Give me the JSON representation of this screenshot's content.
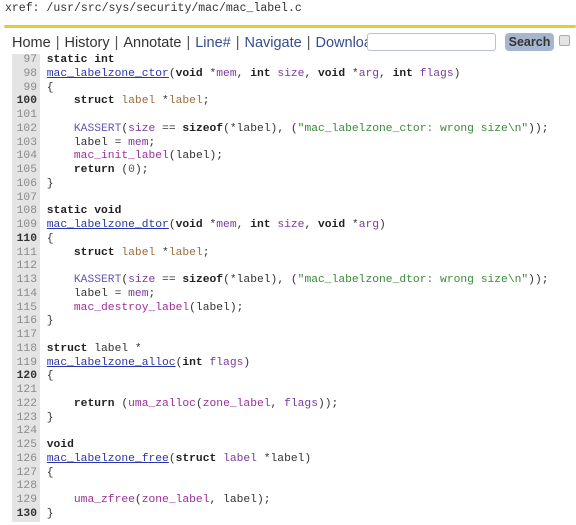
{
  "xref": {
    "prefix": "xref:",
    "path": " /usr/src/sys/security/mac/mac_label.c"
  },
  "nav": {
    "home": "Home",
    "history": "History",
    "annotate": "Annotate",
    "line": "Line#",
    "navigate": "Navigate",
    "download": "Download",
    "separator": "|",
    "search_value": "",
    "search_button": "Search"
  },
  "colors": {
    "accent_line": "#e8c93c",
    "search_button": "#a7b6cf",
    "link": "#364d8c"
  },
  "code": {
    "lines": [
      {
        "n": "97",
        "bold": false,
        "tokens": [
          [
            "kw",
            "static int"
          ]
        ]
      },
      {
        "n": "98",
        "bold": false,
        "tokens": [
          [
            "fn",
            "mac_labelzone_ctor"
          ],
          [
            "src",
            "("
          ],
          [
            "kw",
            "void"
          ],
          [
            "src",
            " *"
          ],
          [
            "var",
            "mem"
          ],
          [
            "src",
            ", "
          ],
          [
            "kw",
            "int"
          ],
          [
            "src",
            " "
          ],
          [
            "var",
            "size"
          ],
          [
            "src",
            ", "
          ],
          [
            "kw",
            "void"
          ],
          [
            "src",
            " *"
          ],
          [
            "var",
            "arg"
          ],
          [
            "src",
            ", "
          ],
          [
            "kw",
            "int"
          ],
          [
            "src",
            " "
          ],
          [
            "var",
            "flags"
          ],
          [
            "src",
            ")"
          ]
        ]
      },
      {
        "n": "99",
        "bold": false,
        "tokens": [
          [
            "src",
            "{"
          ]
        ]
      },
      {
        "n": "100",
        "bold": true,
        "tokens": [
          [
            "src",
            "    "
          ],
          [
            "kw",
            "struct"
          ],
          [
            "src",
            " "
          ],
          [
            "type",
            "label"
          ],
          [
            "src",
            " *"
          ],
          [
            "type",
            "label"
          ],
          [
            "src",
            ";"
          ]
        ]
      },
      {
        "n": "101",
        "bold": false,
        "tokens": []
      },
      {
        "n": "102",
        "bold": false,
        "tokens": [
          [
            "src",
            "    "
          ],
          [
            "mac",
            "KASSERT"
          ],
          [
            "src",
            "("
          ],
          [
            "var",
            "size"
          ],
          [
            "src",
            " == "
          ],
          [
            "kw",
            "sizeof"
          ],
          [
            "src",
            "(*label), ("
          ],
          [
            "str",
            "\"mac_labelzone_ctor: wrong size\\n\""
          ],
          [
            "src",
            "));"
          ]
        ]
      },
      {
        "n": "103",
        "bold": false,
        "tokens": [
          [
            "src",
            "    label = "
          ],
          [
            "var",
            "mem"
          ],
          [
            "src",
            ";"
          ]
        ]
      },
      {
        "n": "104",
        "bold": false,
        "tokens": [
          [
            "src",
            "    "
          ],
          [
            "call",
            "mac_init_label"
          ],
          [
            "src",
            "(label);"
          ]
        ]
      },
      {
        "n": "105",
        "bold": false,
        "tokens": [
          [
            "src",
            "    "
          ],
          [
            "kw",
            "return"
          ],
          [
            "src",
            " ("
          ],
          [
            "num",
            "0"
          ],
          [
            "src",
            ");"
          ]
        ]
      },
      {
        "n": "106",
        "bold": false,
        "tokens": [
          [
            "src",
            "}"
          ]
        ]
      },
      {
        "n": "107",
        "bold": false,
        "tokens": []
      },
      {
        "n": "108",
        "bold": false,
        "tokens": [
          [
            "kw",
            "static void"
          ]
        ]
      },
      {
        "n": "109",
        "bold": false,
        "tokens": [
          [
            "fn",
            "mac_labelzone_dtor"
          ],
          [
            "src",
            "("
          ],
          [
            "kw",
            "void"
          ],
          [
            "src",
            " *"
          ],
          [
            "var",
            "mem"
          ],
          [
            "src",
            ", "
          ],
          [
            "kw",
            "int"
          ],
          [
            "src",
            " "
          ],
          [
            "var",
            "size"
          ],
          [
            "src",
            ", "
          ],
          [
            "kw",
            "void"
          ],
          [
            "src",
            " *"
          ],
          [
            "var",
            "arg"
          ],
          [
            "src",
            ")"
          ]
        ]
      },
      {
        "n": "110",
        "bold": true,
        "tokens": [
          [
            "src",
            "{"
          ]
        ]
      },
      {
        "n": "111",
        "bold": false,
        "tokens": [
          [
            "src",
            "    "
          ],
          [
            "kw",
            "struct"
          ],
          [
            "src",
            " "
          ],
          [
            "type",
            "label"
          ],
          [
            "src",
            " *"
          ],
          [
            "type",
            "label"
          ],
          [
            "src",
            ";"
          ]
        ]
      },
      {
        "n": "112",
        "bold": false,
        "tokens": []
      },
      {
        "n": "113",
        "bold": false,
        "tokens": [
          [
            "src",
            "    "
          ],
          [
            "mac",
            "KASSERT"
          ],
          [
            "src",
            "("
          ],
          [
            "var",
            "size"
          ],
          [
            "src",
            " == "
          ],
          [
            "kw",
            "sizeof"
          ],
          [
            "src",
            "(*label), ("
          ],
          [
            "str",
            "\"mac_labelzone_dtor: wrong size\\n\""
          ],
          [
            "src",
            "));"
          ]
        ]
      },
      {
        "n": "114",
        "bold": false,
        "tokens": [
          [
            "src",
            "    label = "
          ],
          [
            "var",
            "mem"
          ],
          [
            "src",
            ";"
          ]
        ]
      },
      {
        "n": "115",
        "bold": false,
        "tokens": [
          [
            "src",
            "    "
          ],
          [
            "call",
            "mac_destroy_label"
          ],
          [
            "src",
            "(label);"
          ]
        ]
      },
      {
        "n": "116",
        "bold": false,
        "tokens": [
          [
            "src",
            "}"
          ]
        ]
      },
      {
        "n": "117",
        "bold": false,
        "tokens": []
      },
      {
        "n": "118",
        "bold": false,
        "tokens": [
          [
            "kw",
            "struct"
          ],
          [
            "src",
            " label *"
          ]
        ]
      },
      {
        "n": "119",
        "bold": false,
        "tokens": [
          [
            "fn",
            "mac_labelzone_alloc"
          ],
          [
            "src",
            "("
          ],
          [
            "kw",
            "int"
          ],
          [
            "src",
            " "
          ],
          [
            "var",
            "flags"
          ],
          [
            "src",
            ")"
          ]
        ]
      },
      {
        "n": "120",
        "bold": true,
        "tokens": [
          [
            "src",
            "{"
          ]
        ]
      },
      {
        "n": "121",
        "bold": false,
        "tokens": []
      },
      {
        "n": "122",
        "bold": false,
        "tokens": [
          [
            "src",
            "    "
          ],
          [
            "kw",
            "return"
          ],
          [
            "src",
            " ("
          ],
          [
            "call",
            "uma_zalloc"
          ],
          [
            "src",
            "("
          ],
          [
            "call",
            "zone_label"
          ],
          [
            "src",
            ", "
          ],
          [
            "var",
            "flags"
          ],
          [
            "src",
            "));"
          ]
        ]
      },
      {
        "n": "123",
        "bold": false,
        "tokens": [
          [
            "src",
            "}"
          ]
        ]
      },
      {
        "n": "124",
        "bold": false,
        "tokens": []
      },
      {
        "n": "125",
        "bold": false,
        "tokens": [
          [
            "kw",
            "void"
          ]
        ]
      },
      {
        "n": "126",
        "bold": false,
        "tokens": [
          [
            "fn",
            "mac_labelzone_free"
          ],
          [
            "src",
            "("
          ],
          [
            "kw",
            "struct"
          ],
          [
            "src",
            " "
          ],
          [
            "var",
            "label"
          ],
          [
            "src",
            " *label)"
          ]
        ]
      },
      {
        "n": "127",
        "bold": false,
        "tokens": [
          [
            "src",
            "{"
          ]
        ]
      },
      {
        "n": "128",
        "bold": false,
        "tokens": []
      },
      {
        "n": "129",
        "bold": false,
        "tokens": [
          [
            "src",
            "    "
          ],
          [
            "call",
            "uma_zfree"
          ],
          [
            "src",
            "("
          ],
          [
            "call",
            "zone_label"
          ],
          [
            "src",
            ", label);"
          ]
        ]
      },
      {
        "n": "130",
        "bold": true,
        "tokens": [
          [
            "src",
            "}"
          ]
        ]
      }
    ]
  }
}
